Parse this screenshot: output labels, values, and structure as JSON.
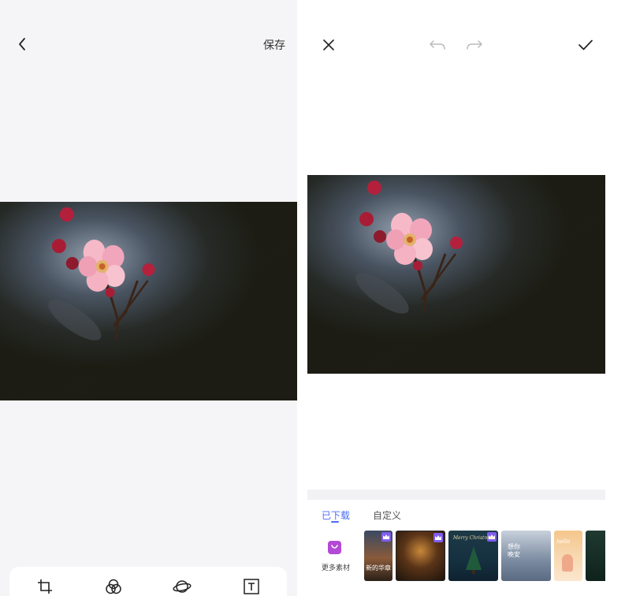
{
  "left_panel": {
    "back_icon": "chevron-left-icon",
    "save_label": "保存",
    "tools": [
      {
        "icon": "crop-icon"
      },
      {
        "icon": "filter-icon"
      },
      {
        "icon": "planet-icon"
      },
      {
        "icon": "text-icon"
      }
    ]
  },
  "right_panel": {
    "close_icon": "close-icon",
    "undo_icon": "undo-icon",
    "redo_icon": "redo-icon",
    "confirm_icon": "check-icon",
    "tabs": [
      {
        "label": "已下载",
        "active": true
      },
      {
        "label": "自定义",
        "active": false
      }
    ],
    "more_materials_label": "更多素材",
    "templates": [
      {
        "premium": true,
        "text": "新的华章"
      },
      {
        "premium": true,
        "text": ""
      },
      {
        "premium": true,
        "text": "Merry Christmas"
      },
      {
        "premium": false,
        "text": "想你 晚安"
      },
      {
        "premium": false,
        "text": "hello"
      },
      {
        "premium": false,
        "text": ""
      }
    ]
  },
  "colors": {
    "accent": "#4a6cf7",
    "premium_badge": "#7f5cf0",
    "store_icon": "#b24ad6"
  }
}
